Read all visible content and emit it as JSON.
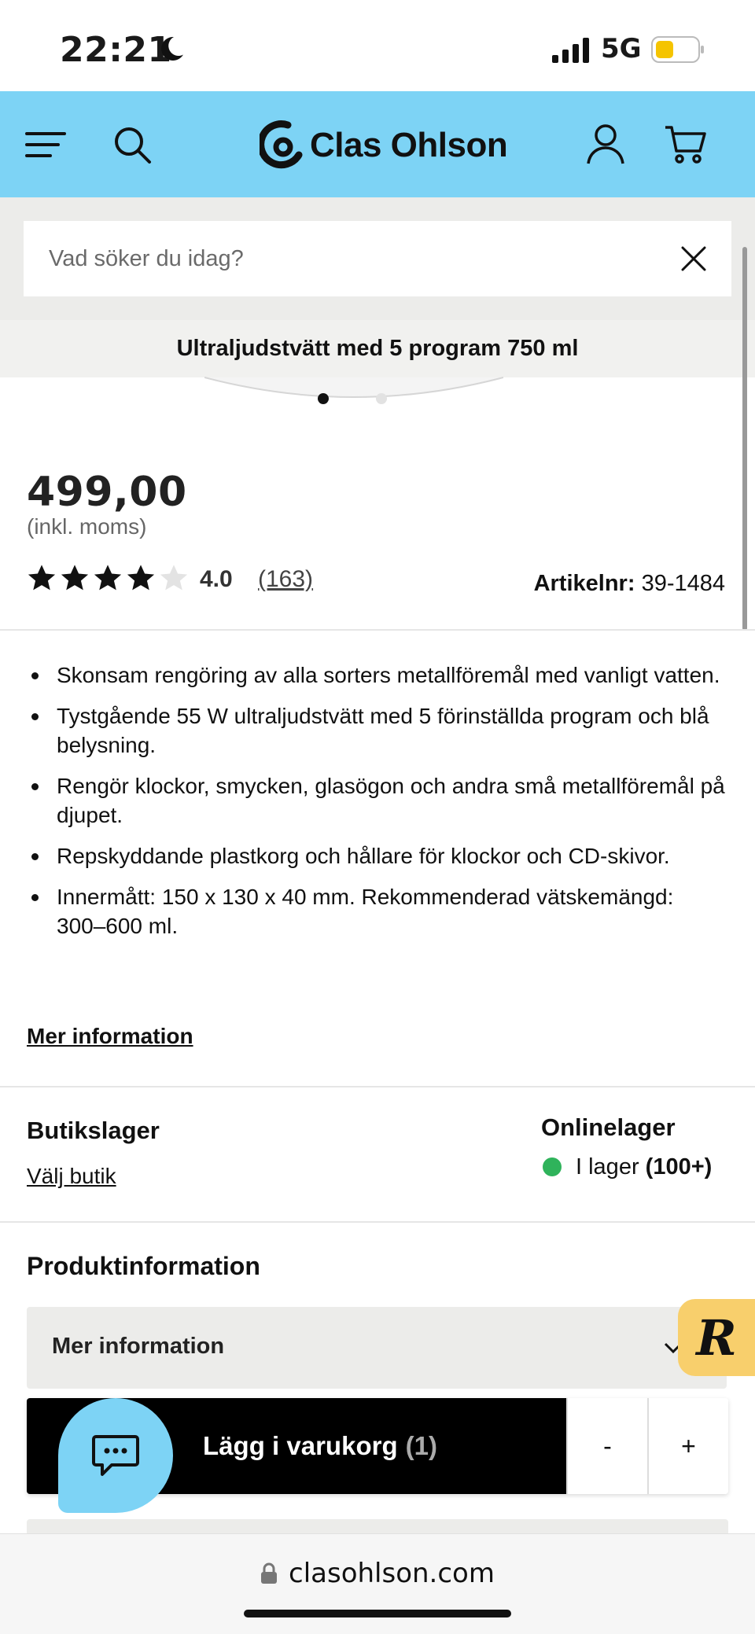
{
  "status_bar": {
    "time": "22:21",
    "network": "5G",
    "battery_color": "#f5c400"
  },
  "header": {
    "brand": "Clas Ohlson",
    "bg_color": "#7dd3f5",
    "icons": [
      "menu-icon",
      "search-icon",
      "account-icon",
      "cart-icon"
    ]
  },
  "search": {
    "placeholder": "Vad söker du idag?"
  },
  "product": {
    "sticky_title": "Ultraljudstvätt med 5 program 750 ml",
    "price": "499,00",
    "vat_note": "(inkl. moms)",
    "rating": {
      "stars_filled": 4,
      "stars_total": 5,
      "value": "4.0",
      "count": "(163)"
    },
    "article_label": "Artikelnr:",
    "article_number": "39-1484",
    "image_dots": {
      "count": 2,
      "active": 0
    }
  },
  "bullets": [
    "Skonsam rengöring av alla sorters metallföremål med vanligt vatten.",
    "Tystgående 55 W ultraljudstvätt med 5 förinställda program och blå belysning.",
    "Rengör klockor, smycken, glasögon och andra små metallföremål på djupet.",
    "Repskyddande plastkorg och hållare för klockor och CD-skivor.",
    "Innermått: 150 x 130 x 40 mm. Rekommenderad vätskemängd: 300–600 ml."
  ],
  "more_info_link": "Mer information",
  "stock": {
    "store_heading": "Butikslager",
    "store_link": "Välj butik",
    "online_heading": "Onlinelager",
    "online_status": "I lager",
    "online_count": "(100+)",
    "status_color": "#2fb35b"
  },
  "product_info": {
    "heading": "Produktinformation",
    "accordion_label": "Mer information"
  },
  "cart": {
    "add_label": "Lägg i varukorg",
    "qty": "(1)",
    "minus": "-",
    "plus": "+"
  },
  "badge": {
    "letter": "R",
    "color": "#f8cf6c"
  },
  "browser": {
    "url": "clasohlson.com"
  }
}
